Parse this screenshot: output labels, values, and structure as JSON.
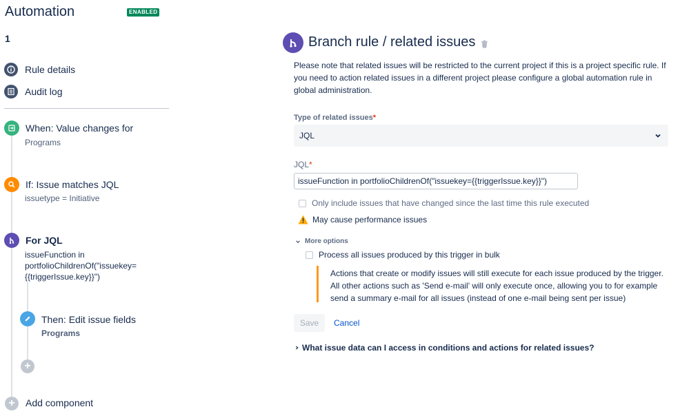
{
  "app": {
    "title": "Automation",
    "status_badge": "ENABLED",
    "rule_name": "1"
  },
  "sidebar": {
    "nav": [
      {
        "label": "Rule details",
        "icon": "info-icon"
      },
      {
        "label": "Audit log",
        "icon": "list-icon"
      }
    ],
    "steps": {
      "trigger": {
        "title": "When: Value changes for",
        "sub": "Programs",
        "icon": "trigger-icon",
        "color": "#36b37e"
      },
      "condition": {
        "title": "If: Issue matches JQL",
        "sub": "issuetype = Initiative",
        "icon": "search-icon",
        "color": "#ff8b00"
      },
      "branch": {
        "title": "For JQL",
        "body": "issueFunction in portfolioChildrenOf(\"issuekey={{triggerIssue.key}}\")",
        "icon": "branch-icon",
        "color": "#5e4db2"
      },
      "action": {
        "title": "Then: Edit issue fields",
        "sub": "Programs",
        "icon": "pencil-icon",
        "color": "#4aa5e4"
      }
    },
    "add_component": "Add component"
  },
  "main": {
    "title": "Branch rule / related issues",
    "note": "Please note that related issues will be restricted to the current project if this is a project specific rule. If you need to action related issues in a different project please configure a global automation rule in global administration.",
    "type_label": "Type of related issues",
    "type_value": "JQL",
    "jql_label": "JQL",
    "jql_value": "issueFunction in portfolioChildrenOf(\"issuekey={{triggerIssue.key}}\")",
    "changed_only_label": "Only include issues that have changed since the last time this rule executed",
    "warning": "May cause performance issues",
    "more_options": "More options",
    "bulk_label": "Process all issues produced by this trigger in bulk",
    "bulk_info": "Actions that create or modify issues will still execute for each issue produced by the trigger. All other actions such as 'Send e-mail' will only execute once, allowing you to for example send a summary e-mail for all issues (instead of one e-mail being sent per issue)",
    "save": "Save",
    "cancel": "Cancel",
    "faq": "What issue data can I access in conditions and actions for related issues?"
  }
}
